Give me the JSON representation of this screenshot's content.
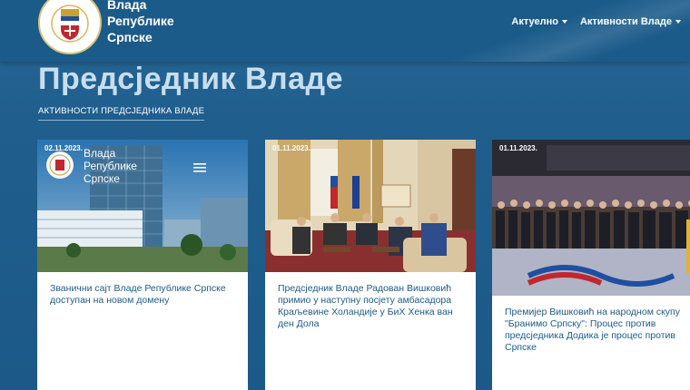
{
  "header": {
    "brand_line1": "Влада",
    "brand_line2": "Републике",
    "brand_line3": "Српске",
    "nav": [
      {
        "label": "Актуелно"
      },
      {
        "label": "Активности Владе"
      }
    ]
  },
  "page": {
    "title": "Предсједник Владе",
    "subtitle": "АКТИВНОСТИ ПРЕДСЈЕДНИКА ВЛАДЕ"
  },
  "cards": [
    {
      "date": "02.11.2023.",
      "text": "Званични сајт Владе Републике Српске доступан на новом домену",
      "image_brand_line1": "Влада",
      "image_brand_line2": "Републике",
      "image_brand_line3": "Српске"
    },
    {
      "date": "01.11.2023.",
      "text": "Предсједник Владе Радован Вишковић примио у наступну посјету амбасадора Краљевине Холандије у БиХ Хенка ван ден Дола"
    },
    {
      "date": "01.11.2023.",
      "text": "Премијер Вишковић на народном скупу \"Бранимо Српску\": Процес против предсједника Додика је процес против Српске"
    }
  ],
  "colors": {
    "header_bg": "#1b5b8a",
    "title": "#c8deee",
    "link_text": "#1b5b8a"
  }
}
